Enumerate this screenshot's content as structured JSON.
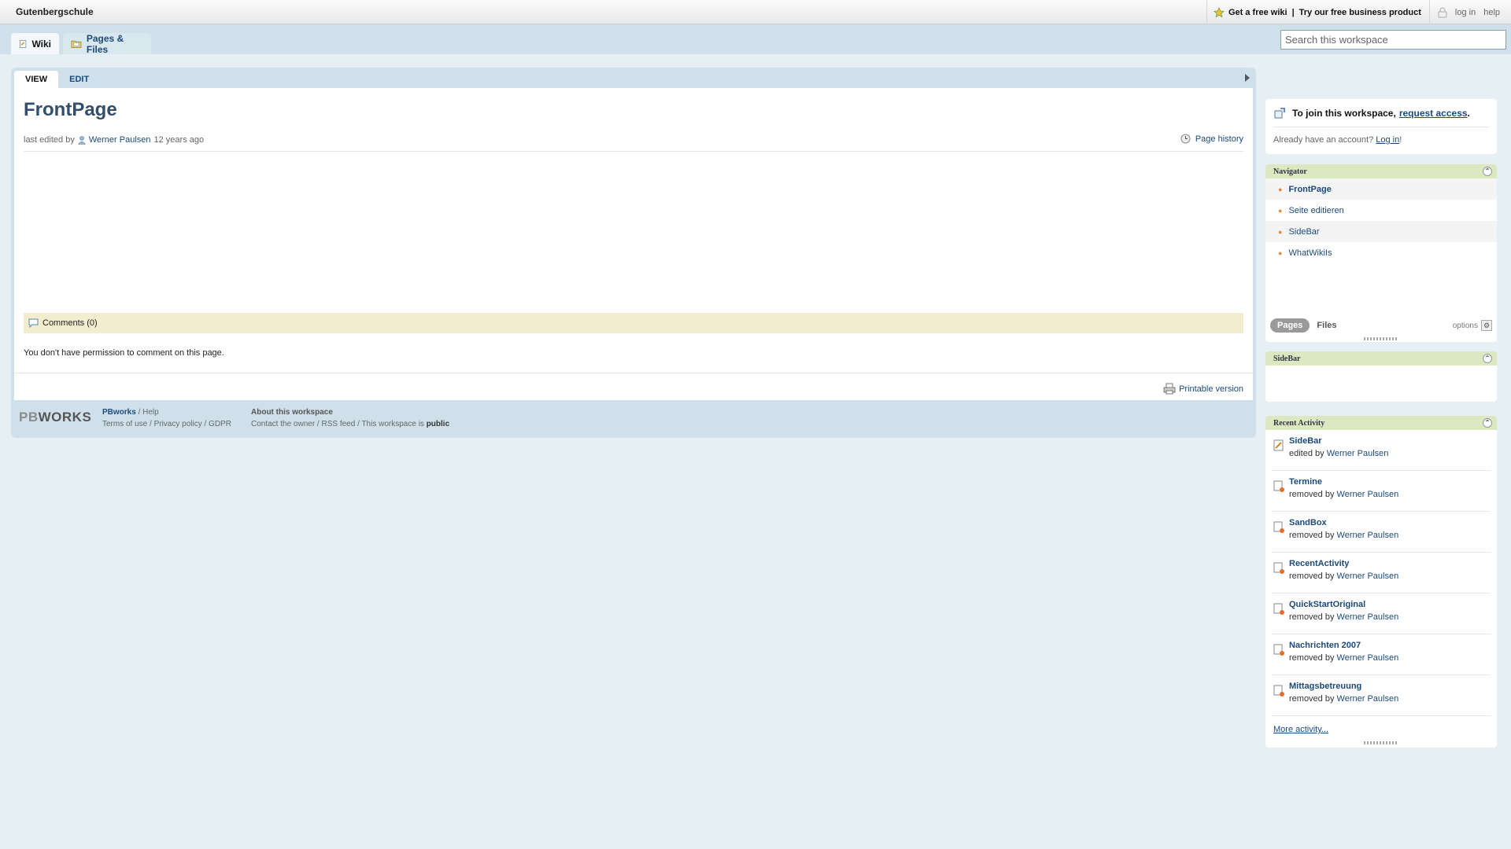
{
  "topbar": {
    "workspace_name": "Gutenbergschule",
    "promo_free_wiki": "Get a free wiki",
    "promo_separator": "|",
    "promo_business": "Try our free business product",
    "login": "log in",
    "help": "help"
  },
  "tabs": {
    "wiki": "Wiki",
    "pages_files": "Pages & Files"
  },
  "search": {
    "placeholder": "Search this workspace"
  },
  "page": {
    "view_tab": "VIEW",
    "edit_tab": "EDIT",
    "title": "FrontPage",
    "last_edited_prefix": "last edited by",
    "last_edited_user": "Werner Paulsen",
    "last_edited_time": "12 years ago",
    "page_history": "Page history",
    "comments": "Comments (0)",
    "no_permission": "You don't have permission to comment on this page.",
    "printable": "Printable version"
  },
  "footer": {
    "logo_pb": "PB",
    "logo_works": "WORKS",
    "pbworks": "PBworks",
    "help": " / Help",
    "links1": "Terms of use / Privacy policy / GDPR",
    "about": "About this workspace",
    "links2": "Contact the owner / RSS feed / This workspace is ",
    "public": "public"
  },
  "join": {
    "text": "To join this workspace,",
    "request": "request access",
    "period": ".",
    "already": "Already have an account?",
    "login": "Log in",
    "exclaim": "!"
  },
  "navigator": {
    "title": "Navigator",
    "items": [
      "FrontPage",
      "Seite editieren",
      "SideBar",
      "WhatWikiIs"
    ],
    "pages_tab": "Pages",
    "files_tab": "Files",
    "options": "options"
  },
  "sidebar_box": {
    "title": "SideBar"
  },
  "recent": {
    "title": "Recent Activity",
    "items": [
      {
        "title": "SideBar",
        "action": "edited by",
        "user": "Werner Paulsen"
      },
      {
        "title": "Termine",
        "action": "removed by",
        "user": "Werner Paulsen"
      },
      {
        "title": "SandBox",
        "action": "removed by",
        "user": "Werner Paulsen"
      },
      {
        "title": "RecentActivity",
        "action": "removed by",
        "user": "Werner Paulsen"
      },
      {
        "title": "QuickStartOriginal",
        "action": "removed by",
        "user": "Werner Paulsen"
      },
      {
        "title": "Nachrichten 2007",
        "action": "removed by",
        "user": "Werner Paulsen"
      },
      {
        "title": "Mittagsbetreuung",
        "action": "removed by",
        "user": "Werner Paulsen"
      }
    ],
    "more": "More activity..."
  }
}
